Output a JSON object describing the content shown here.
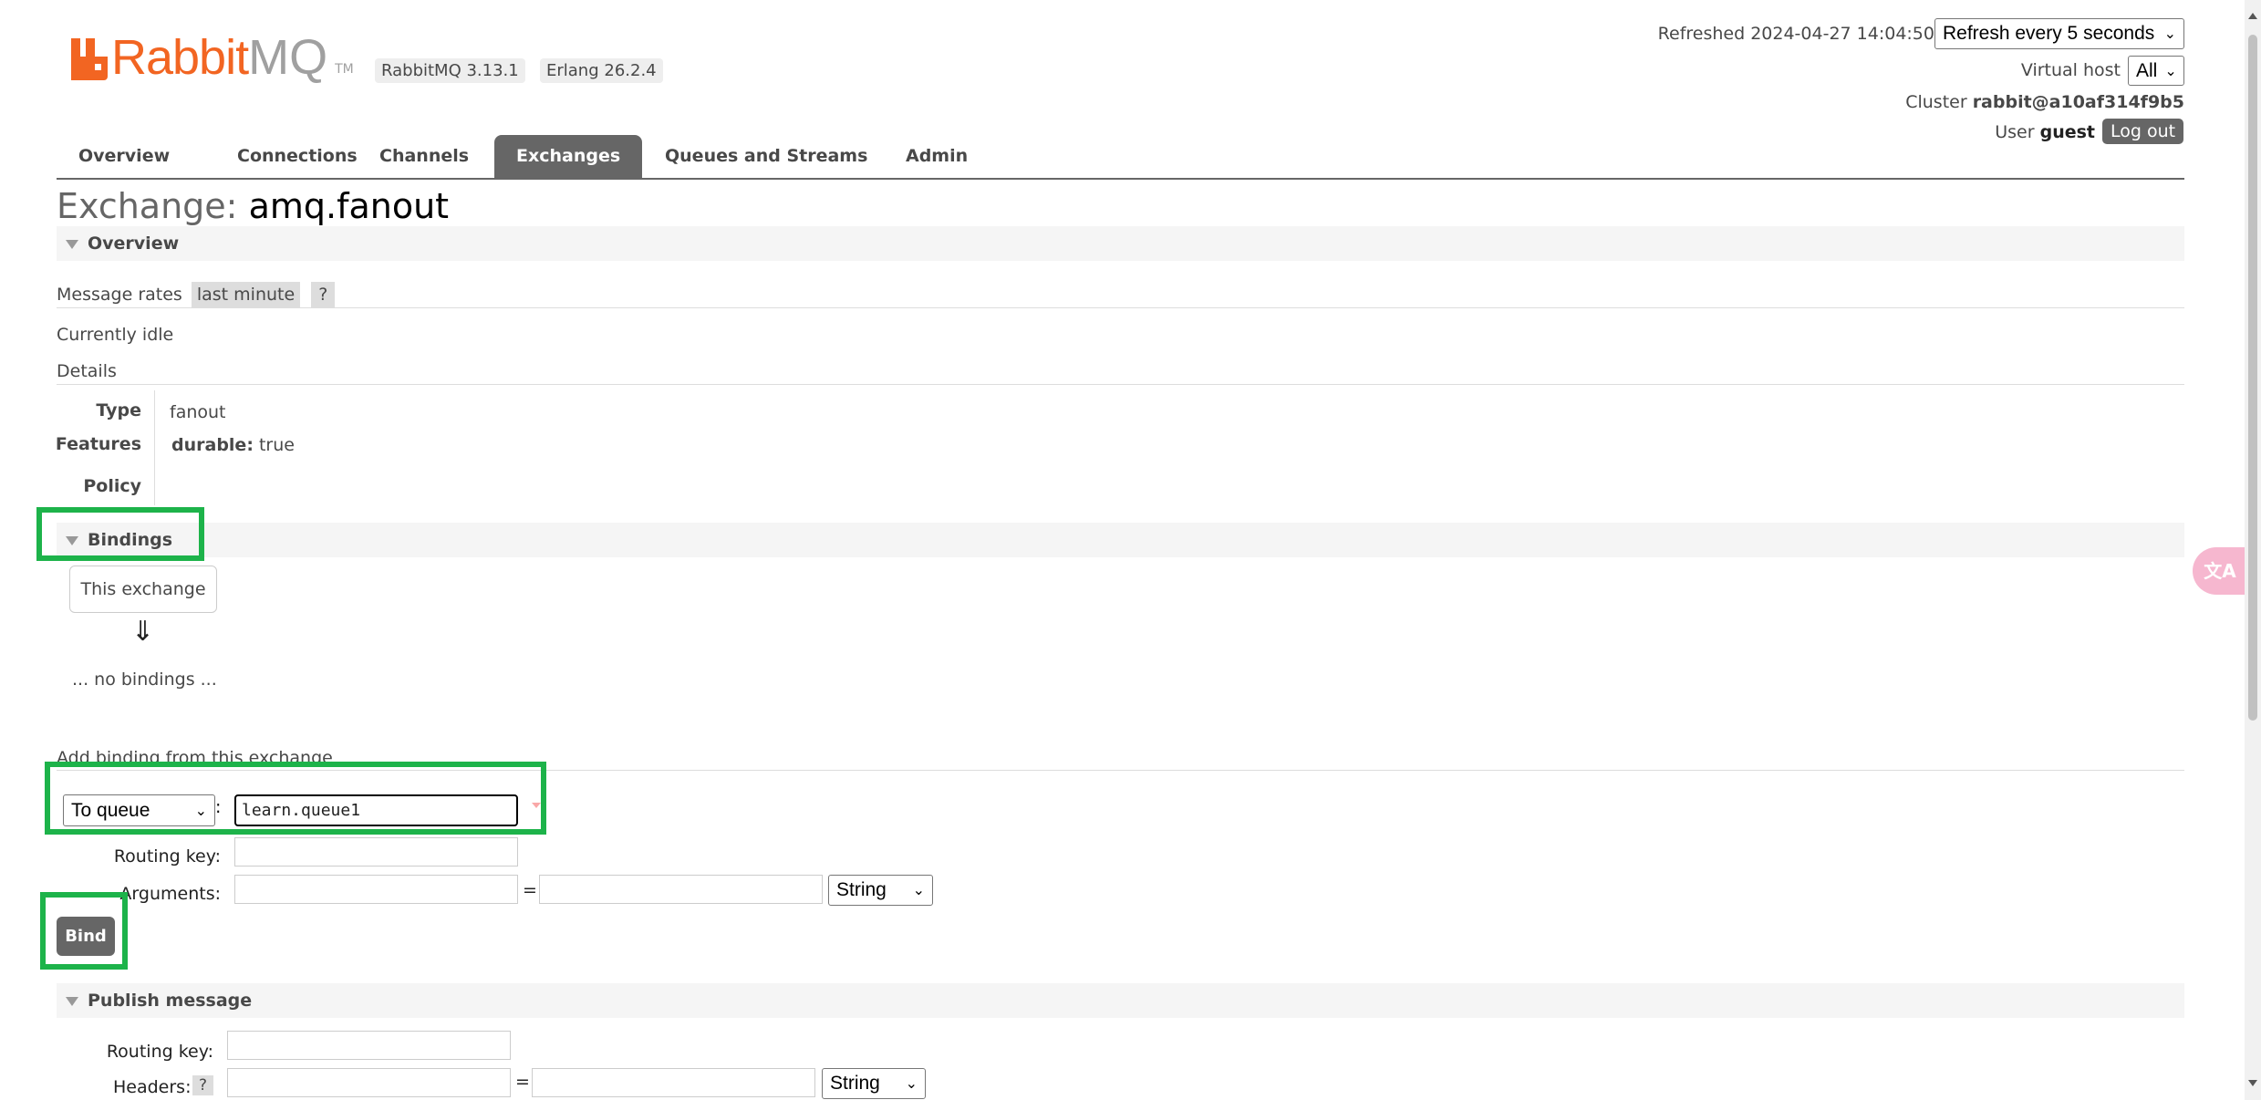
{
  "header": {
    "logo_primary": "Rabbit",
    "logo_secondary": "MQ",
    "logo_tm": "TM",
    "version": "RabbitMQ 3.13.1",
    "erlang": "Erlang 26.2.4",
    "refreshed_label": "Refreshed 2024-04-27 14:04:50",
    "refresh_select": "Refresh every 5 seconds",
    "virtual_host_label": "Virtual host",
    "virtual_host_value": "All",
    "cluster_label": "Cluster",
    "cluster_value": "rabbit@a10af314f9b5",
    "user_label": "User",
    "user_value": "guest",
    "logout": "Log out"
  },
  "tabs": [
    {
      "label": "Overview"
    },
    {
      "label": "Connections"
    },
    {
      "label": "Channels"
    },
    {
      "label": "Exchanges",
      "active": true
    },
    {
      "label": "Queues and Streams"
    },
    {
      "label": "Admin"
    }
  ],
  "page": {
    "title_prefix": "Exchange:",
    "title_name": "amq.fanout"
  },
  "overview": {
    "heading": "Overview",
    "message_rates_label": "Message rates",
    "message_rates_chip": "last minute",
    "help": "?",
    "idle": "Currently idle",
    "details_label": "Details",
    "type_label": "Type",
    "type_value": "fanout",
    "features_label": "Features",
    "durable_label": "durable:",
    "durable_value": "true",
    "policy_label": "Policy"
  },
  "bindings": {
    "heading": "Bindings",
    "this_exchange": "This exchange",
    "arrow": "⇓",
    "no_bindings": "... no bindings ...",
    "add_label": "Add binding from this exchange",
    "destination_select": "To queue",
    "colon": ":",
    "queue_value": "learn.queue1",
    "routing_key_label": "Routing key:",
    "arguments_label": "Arguments:",
    "equals": "=",
    "type_select": "String",
    "bind_button": "Bind"
  },
  "publish": {
    "heading": "Publish message",
    "routing_key_label": "Routing key:",
    "headers_label": "Headers:",
    "help": "?",
    "equals": "=",
    "type_select": "String"
  },
  "colors": {
    "brand_orange": "#f26522",
    "highlight_green": "#1db34a",
    "tab_active": "#666666"
  },
  "icons": {
    "translate": "translate-icon",
    "collapse": "triangle-down-icon"
  }
}
